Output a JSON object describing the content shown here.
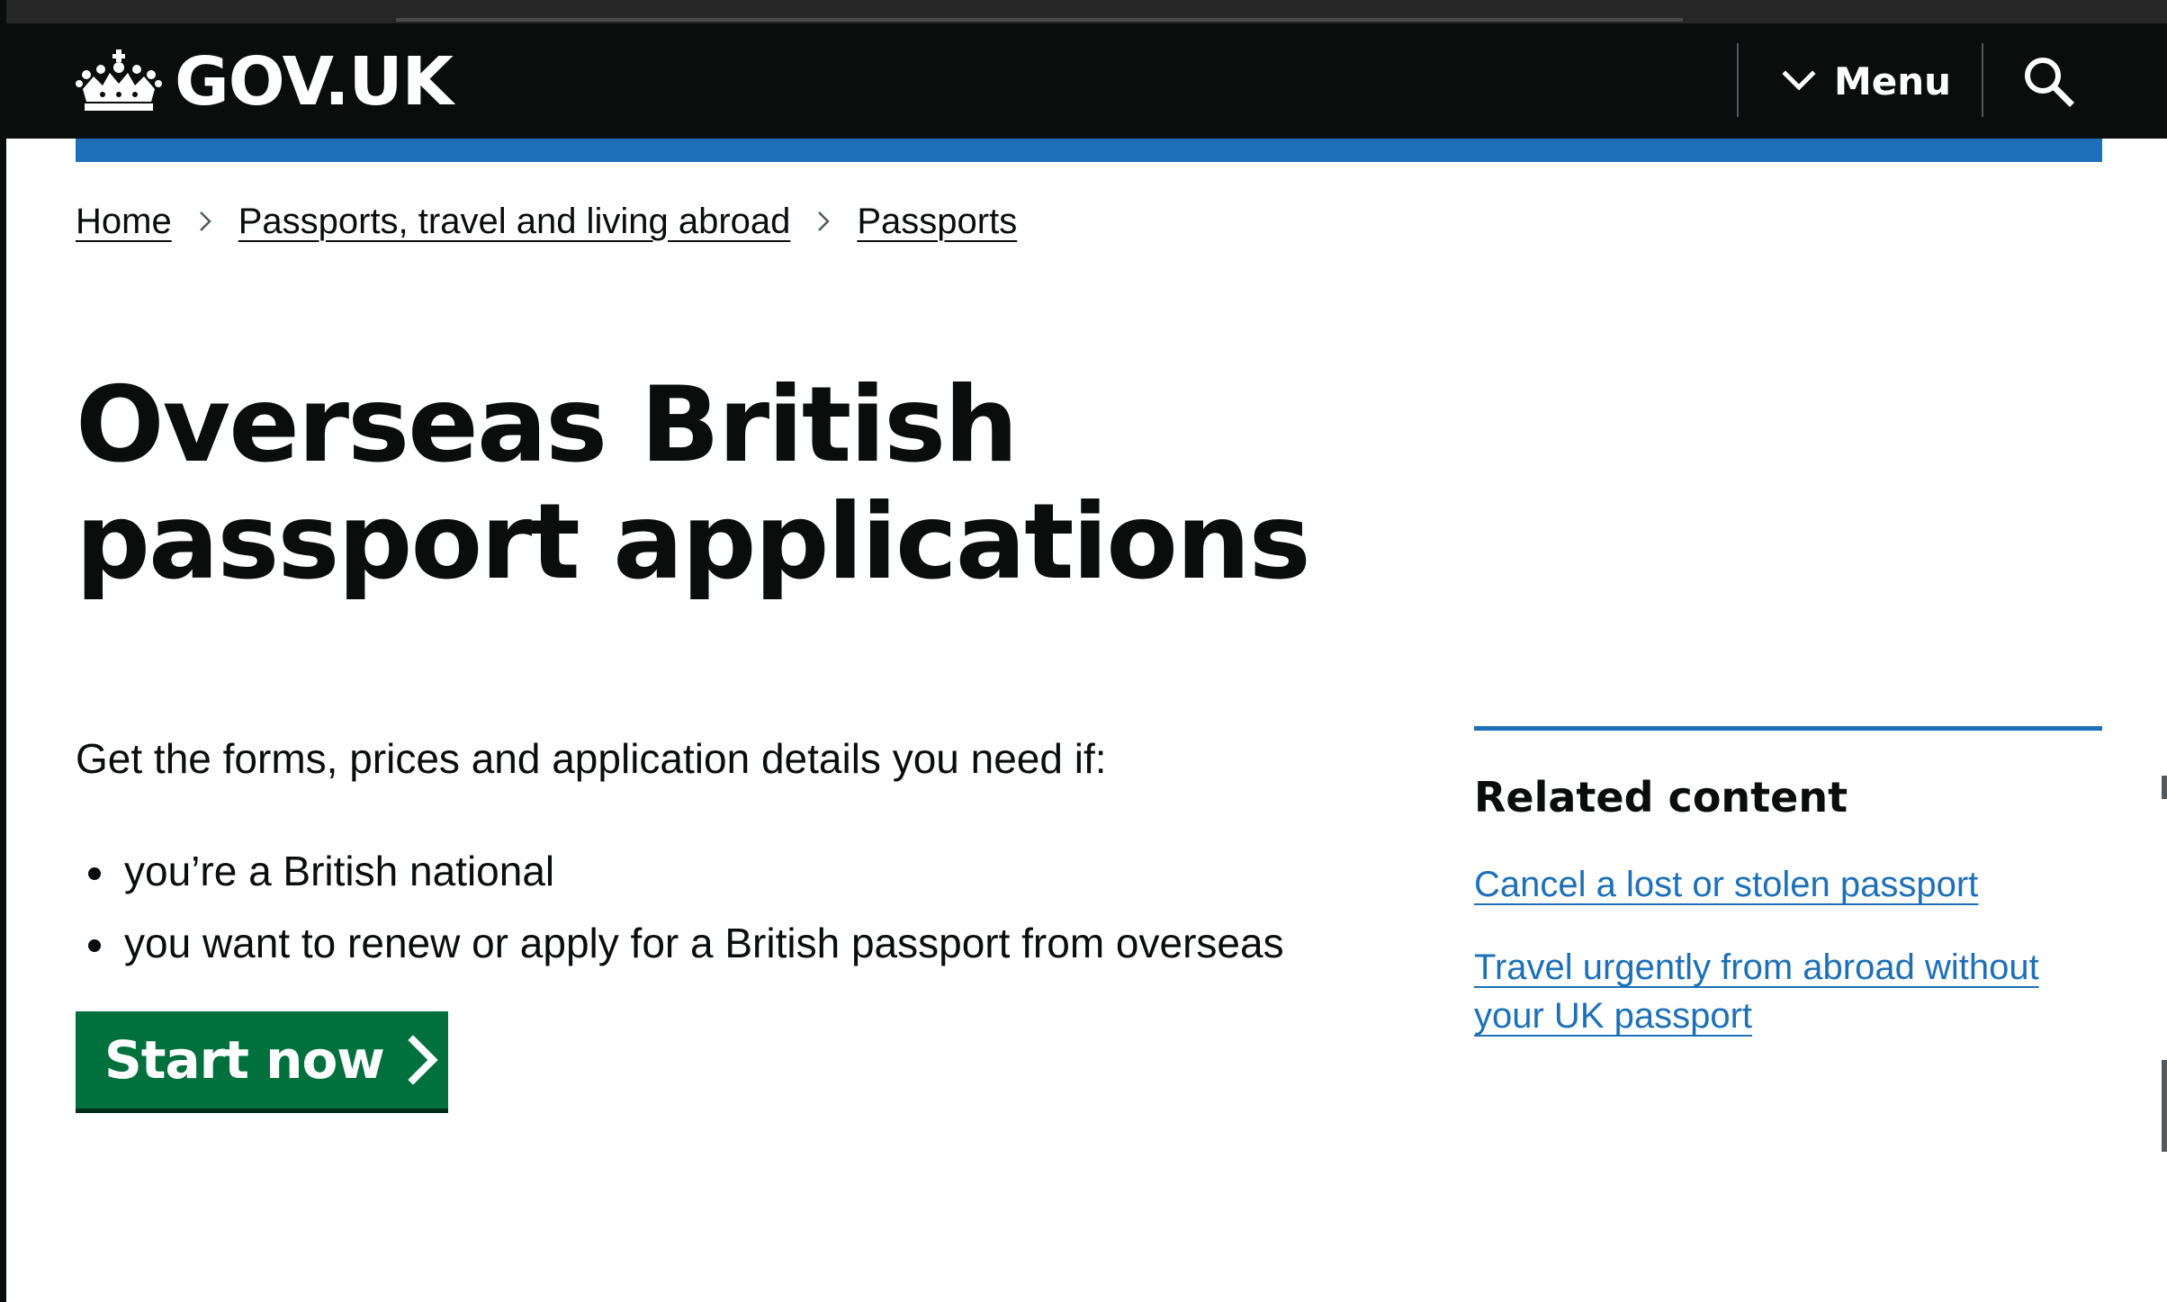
{
  "header": {
    "logo_text": "GOV.UK",
    "menu_label": "Menu",
    "colors": {
      "background": "#0b0c0c",
      "accent_bar": "#1d70b8"
    }
  },
  "icons": {
    "logo": "crown-icon",
    "menu": "chevron-down-icon",
    "search": "search-icon",
    "breadcrumb_separator": "chevron-right-icon",
    "start": "chevron-right-icon"
  },
  "breadcrumb": [
    {
      "label": "Home"
    },
    {
      "label": "Passports, travel and living abroad"
    },
    {
      "label": "Passports"
    }
  ],
  "main": {
    "title": "Overseas British passport applications",
    "lead": "Get the forms, prices and application details you need if:",
    "bullets": [
      "you’re a British national",
      "you want to renew or apply for a British passport from overseas"
    ],
    "start_button": {
      "label": "Start now",
      "color": "#00703c"
    }
  },
  "related": {
    "title": "Related content",
    "links": [
      {
        "label": "Cancel a lost or stolen passport"
      },
      {
        "label": "Travel urgently from abroad without your UK passport"
      }
    ],
    "link_color": "#1d70b8"
  }
}
